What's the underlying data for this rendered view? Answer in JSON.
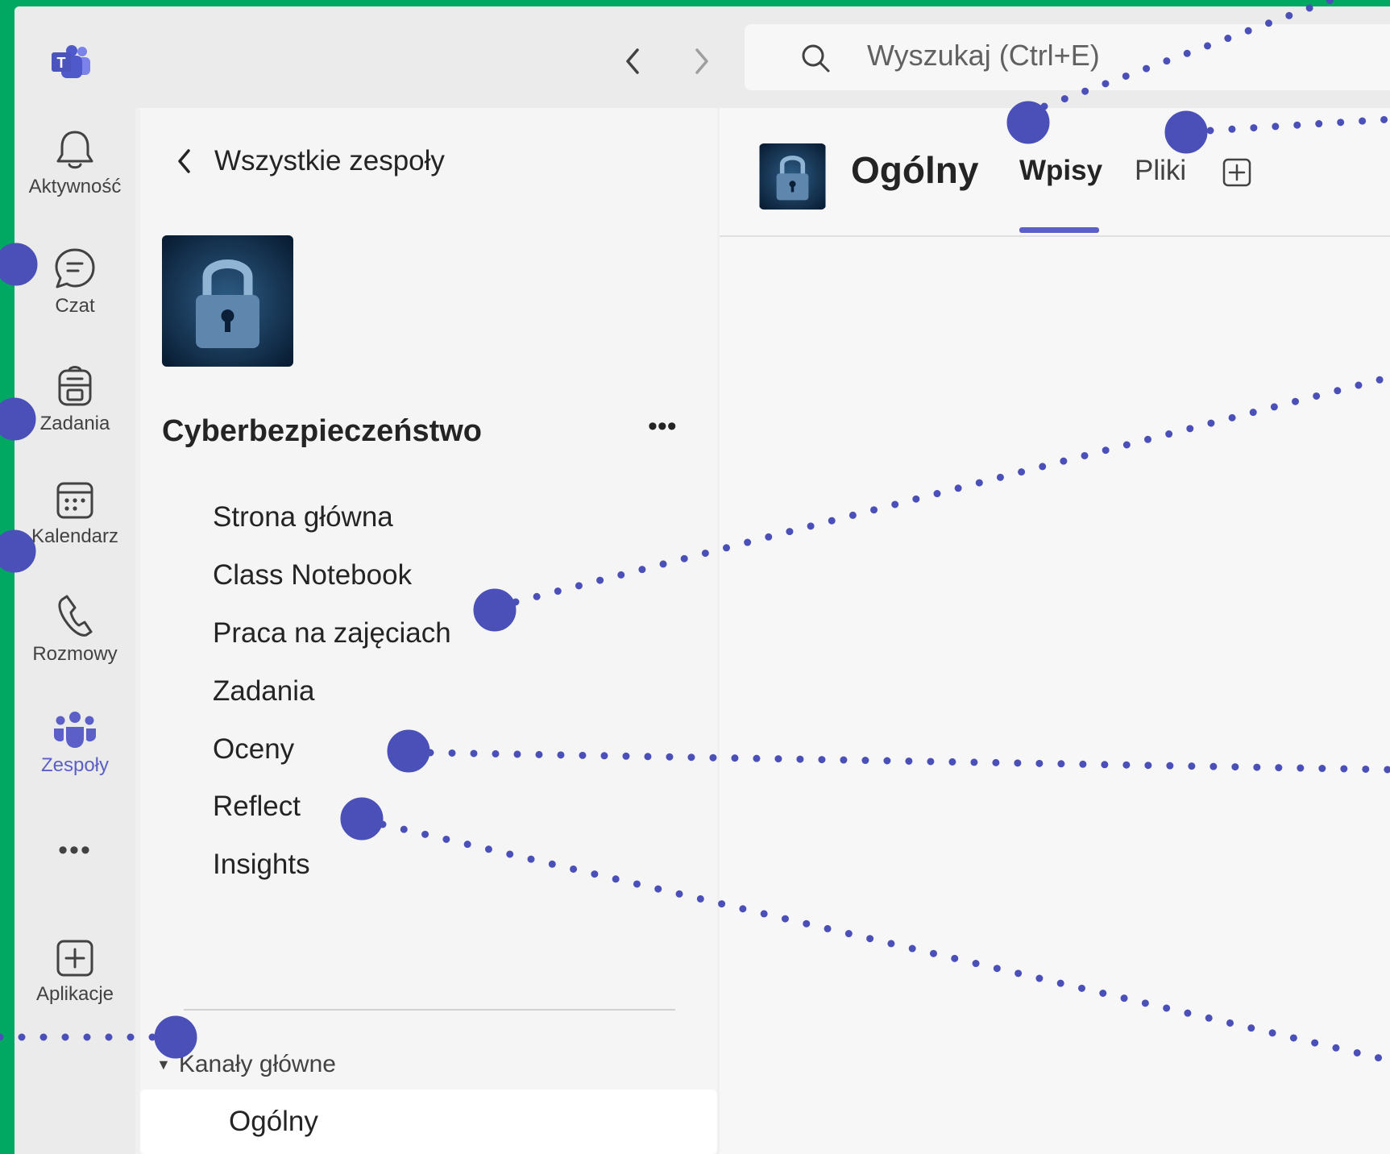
{
  "titlebar": {
    "search_placeholder": "Wyszukaj (Ctrl+E)"
  },
  "rail": {
    "items": [
      {
        "label": "Aktywność",
        "icon": "bell-icon"
      },
      {
        "label": "Czat",
        "icon": "chat-icon"
      },
      {
        "label": "Zadania",
        "icon": "backpack-icon"
      },
      {
        "label": "Kalendarz",
        "icon": "calendar-icon"
      },
      {
        "label": "Rozmowy",
        "icon": "phone-icon"
      },
      {
        "label": "Zespoły",
        "icon": "teams-icon",
        "active": true
      },
      {
        "label": "Aplikacje",
        "icon": "add-app-icon"
      }
    ],
    "more": "•••"
  },
  "panel": {
    "back_label": "Wszystkie zespoły",
    "team_name": "Cyberbezpieczeństwo",
    "team_more": "•••",
    "menu": [
      "Strona główna",
      "Class Notebook",
      "Praca na zajęciach",
      "Zadania",
      "Oceny",
      "Reflect",
      "Insights"
    ],
    "section_label": "Kanały główne",
    "channel": "Ogólny"
  },
  "main": {
    "channel_title": "Ogólny",
    "tabs": [
      {
        "label": "Wpisy",
        "active": true
      },
      {
        "label": "Pliki",
        "active": false
      }
    ]
  },
  "colors": {
    "frame": "#01a862",
    "accent": "#5b5fc7",
    "annotation": "#4b50b8"
  }
}
